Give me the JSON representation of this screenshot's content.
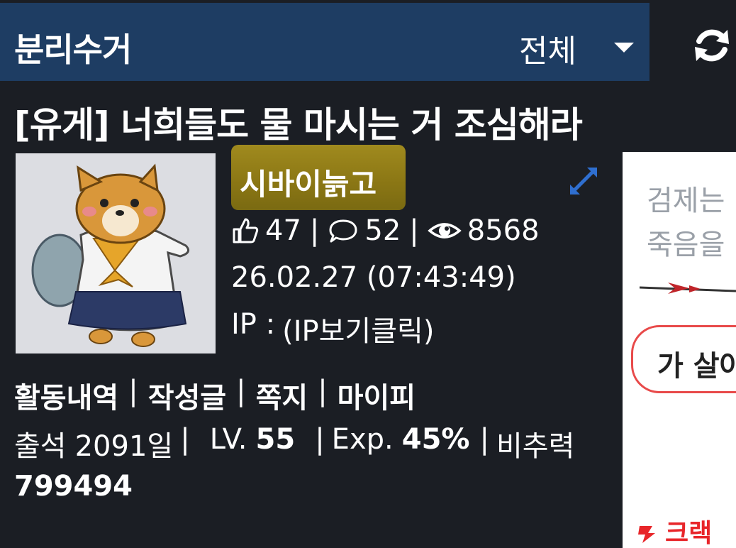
{
  "header": {
    "board_name": "분리수거",
    "filter_label": "전체"
  },
  "post": {
    "title": "[유게] 너희들도 물 마시는 거 조심해라",
    "author": "시바이늙고",
    "likes": "47",
    "comments": "52",
    "views": "8568",
    "date": "26.02.27 (07:43:49)",
    "ip_label": "IP :",
    "ip_value": "(IP보기클릭)"
  },
  "user_links": [
    "활동내역",
    "작성글",
    "쪽지",
    "마이피"
  ],
  "user_info": {
    "attendance_label": "출석",
    "attendance_value": "2091일",
    "level_label": "LV.",
    "level_value": "55",
    "exp_label": "Exp.",
    "exp_value": "45%",
    "contribution_label": "비추력",
    "contribution_value": "799494"
  },
  "ad": {
    "line1": "검제는",
    "line2": "죽음을",
    "pill": "가 살아",
    "logo": "크랙"
  },
  "colors": {
    "header_bg": "#1e3d63",
    "page_bg": "#1b1e24",
    "nick_badge": "#8a7614",
    "expand_icon": "#2f6fd0"
  },
  "icons": [
    "refresh-icon",
    "caret-down-icon",
    "expand-icon",
    "thumbs-up-icon",
    "comment-icon",
    "eye-icon"
  ]
}
